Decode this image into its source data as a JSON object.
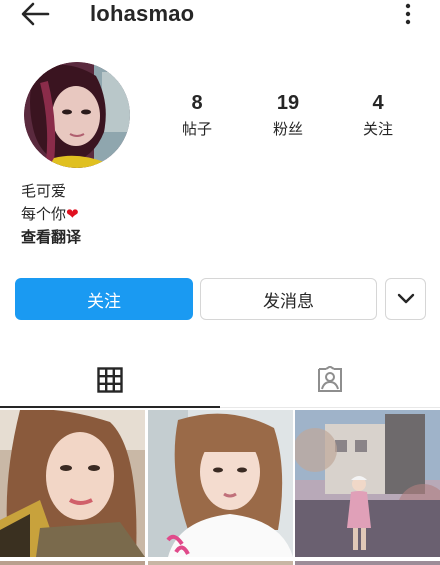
{
  "header": {
    "username": "lohasmao",
    "back_icon": "arrow-left-icon",
    "more_icon": "more-vertical-icon"
  },
  "profile": {
    "avatar": "profile-avatar-photo",
    "stats": [
      {
        "value": "8",
        "label": "帖子"
      },
      {
        "value": "19",
        "label": "粉丝"
      },
      {
        "value": "4",
        "label": "关注"
      }
    ]
  },
  "bio": {
    "name": "毛可爱",
    "line2_text": "每个你",
    "line2_emoji": "❤",
    "translate": "查看翻译"
  },
  "actions": {
    "follow": "关注",
    "message": "发消息",
    "dropdown_icon": "chevron-down-icon"
  },
  "tabs": [
    {
      "icon": "grid-icon",
      "selected": true
    },
    {
      "icon": "tagged-person-icon",
      "selected": false
    }
  ],
  "colors": {
    "accent": "#1a9af2",
    "text": "#262626",
    "border": "#d6d6d6",
    "heart": "#e0101f"
  }
}
